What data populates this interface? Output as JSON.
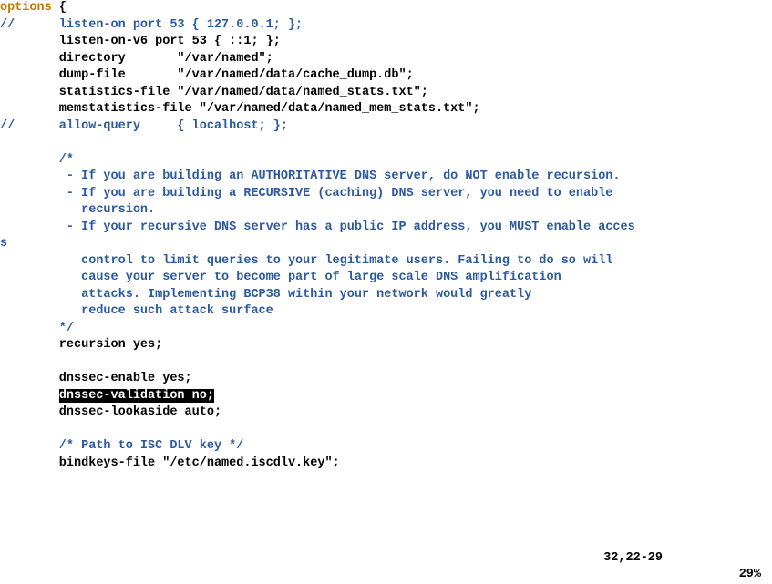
{
  "editor": {
    "lines": [
      {
        "segments": [
          {
            "cls": "keyword",
            "t": "options"
          },
          {
            "cls": "normal",
            "t": " {"
          }
        ]
      },
      {
        "segments": [
          {
            "cls": "comment",
            "t": "//      listen-on port 53 { 127.0.0.1; };"
          }
        ]
      },
      {
        "segments": [
          {
            "cls": "normal",
            "t": "        listen-on-v6 port 53 { ::1; };"
          }
        ]
      },
      {
        "segments": [
          {
            "cls": "normal",
            "t": "        directory       \"/var/named\";"
          }
        ]
      },
      {
        "segments": [
          {
            "cls": "normal",
            "t": "        dump-file       \"/var/named/data/cache_dump.db\";"
          }
        ]
      },
      {
        "segments": [
          {
            "cls": "normal",
            "t": "        statistics-file \"/var/named/data/named_stats.txt\";"
          }
        ]
      },
      {
        "segments": [
          {
            "cls": "normal",
            "t": "        memstatistics-file \"/var/named/data/named_mem_stats.txt\";"
          }
        ]
      },
      {
        "segments": [
          {
            "cls": "comment",
            "t": "//      allow-query     { localhost; };"
          }
        ]
      },
      {
        "segments": [
          {
            "cls": "normal",
            "t": " "
          }
        ]
      },
      {
        "segments": [
          {
            "cls": "comment",
            "t": "        /*"
          }
        ]
      },
      {
        "segments": [
          {
            "cls": "comment",
            "t": "         - If you are building an AUTHORITATIVE DNS server, do NOT enable recursion."
          }
        ]
      },
      {
        "segments": [
          {
            "cls": "comment",
            "t": "         - If you are building a RECURSIVE (caching) DNS server, you need to enable"
          }
        ]
      },
      {
        "segments": [
          {
            "cls": "comment",
            "t": "           recursion."
          }
        ]
      },
      {
        "segments": [
          {
            "cls": "comment",
            "t": "         - If your recursive DNS server has a public IP address, you MUST enable acces"
          }
        ]
      },
      {
        "segments": [
          {
            "cls": "comment",
            "t": "s"
          }
        ]
      },
      {
        "segments": [
          {
            "cls": "comment",
            "t": "           control to limit queries to your legitimate users. Failing to do so will"
          }
        ]
      },
      {
        "segments": [
          {
            "cls": "comment",
            "t": "           cause your server to become part of large scale DNS amplification"
          }
        ]
      },
      {
        "segments": [
          {
            "cls": "comment",
            "t": "           attacks. Implementing BCP38 within your network would greatly"
          }
        ]
      },
      {
        "segments": [
          {
            "cls": "comment",
            "t": "           reduce such attack surface"
          }
        ]
      },
      {
        "segments": [
          {
            "cls": "comment",
            "t": "        */"
          }
        ]
      },
      {
        "segments": [
          {
            "cls": "normal",
            "t": "        recursion yes;"
          }
        ]
      },
      {
        "segments": [
          {
            "cls": "normal",
            "t": " "
          }
        ]
      },
      {
        "segments": [
          {
            "cls": "normal",
            "t": "        dnssec-enable yes;"
          }
        ]
      },
      {
        "segments": [
          {
            "cls": "normal",
            "t": "        "
          },
          {
            "cls": "hl",
            "t": "dnssec-validation no;"
          }
        ]
      },
      {
        "segments": [
          {
            "cls": "normal",
            "t": "        dnssec-lookaside auto;"
          }
        ]
      },
      {
        "segments": [
          {
            "cls": "normal",
            "t": " "
          }
        ]
      },
      {
        "segments": [
          {
            "cls": "comment",
            "t": "        /* Path to ISC DLV key */"
          }
        ]
      },
      {
        "segments": [
          {
            "cls": "normal",
            "t": "        bindkeys-file \"/etc/named.iscdlv.key\";"
          }
        ]
      }
    ]
  },
  "status": {
    "position": "32,22-29",
    "percent": "29%"
  }
}
